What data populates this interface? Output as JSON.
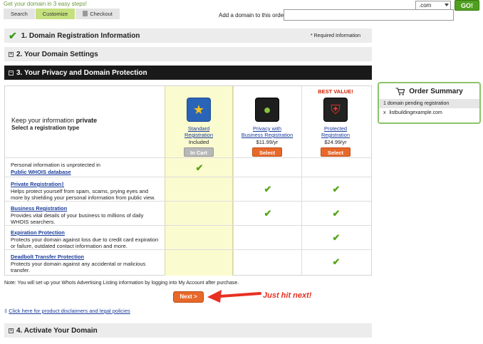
{
  "header": {
    "steps_title": "Get your domain in 3 easy steps!",
    "steps": [
      "Search",
      "Customize",
      "Checkout"
    ],
    "tld_value": ".com",
    "go_label": "GO!",
    "add_label": "Add a domain to this order:",
    "add_value": ""
  },
  "sections": {
    "s1": {
      "title": "1. Domain Registration Information",
      "note": "* Required Information"
    },
    "s2": {
      "title": "2. Your Domain Settings"
    },
    "s3": {
      "title": "3. Your Privacy and Domain Protection"
    },
    "s4": {
      "title": "4. Activate Your Domain"
    }
  },
  "privacy": {
    "keep_prefix": "Keep your information ",
    "keep_bold": "private",
    "keep_sub": "Select a registration type",
    "plans": [
      {
        "best": "",
        "name_line1": "Standard",
        "name_line2": "Registration",
        "price": "Included",
        "button": "In Cart",
        "icon": "star-shield-icon"
      },
      {
        "best": "",
        "name_line1": "Privacy with",
        "name_line2": "Business Registration",
        "price": "$11.99/yr",
        "button": "Select",
        "icon": "lock-globe-icon"
      },
      {
        "best": "BEST VALUE!",
        "name_line1": "Protected",
        "name_line2": "Registration",
        "price": "$24.99/yr",
        "button": "Select",
        "icon": "shield-icon"
      }
    ],
    "features": [
      {
        "label": "Public WHOIS database",
        "prefix": "Personal information is unprotected in",
        "desc": "",
        "checks": [
          true,
          false,
          false
        ]
      },
      {
        "label": "Private Registration‡",
        "prefix": "",
        "desc": "Helps protect yourself from spam, scams, prying eyes and more by shielding your personal information from public view.",
        "checks": [
          false,
          true,
          true
        ]
      },
      {
        "label": "Business Registration",
        "prefix": "",
        "desc": "Provides vital details of your business to millions of daily WHOIS searchers.",
        "checks": [
          false,
          true,
          true
        ]
      },
      {
        "label": "Expiration Protection",
        "prefix": "",
        "desc": "Protects your domain against loss due to credit card expiration or failure, outdated contact information and more.",
        "checks": [
          false,
          false,
          true
        ]
      },
      {
        "label": "Deadbolt Transfer Protection",
        "prefix": "",
        "desc": "Protects your domain against any accidental or malicious transfer.",
        "checks": [
          false,
          false,
          true
        ]
      }
    ]
  },
  "footer": {
    "note": "Note: You will set up your WhoIs Advertising Listing information by logging into My Account after purchase.",
    "next_label": "Next >",
    "annotation": "Just hit next!",
    "disclaimer_mark": "‡",
    "disclaimer": "Click here for product disclaimers and legal policies"
  },
  "order_summary": {
    "title": "Order Summary",
    "pending": "1 domain pending registration",
    "remove": "x",
    "domain": "listbuildingexample.com"
  },
  "colors": {
    "accent_green": "#4fa020",
    "orange": "#e8682a",
    "link": "#1a3c9c",
    "highlight": "#fbfbd0"
  }
}
